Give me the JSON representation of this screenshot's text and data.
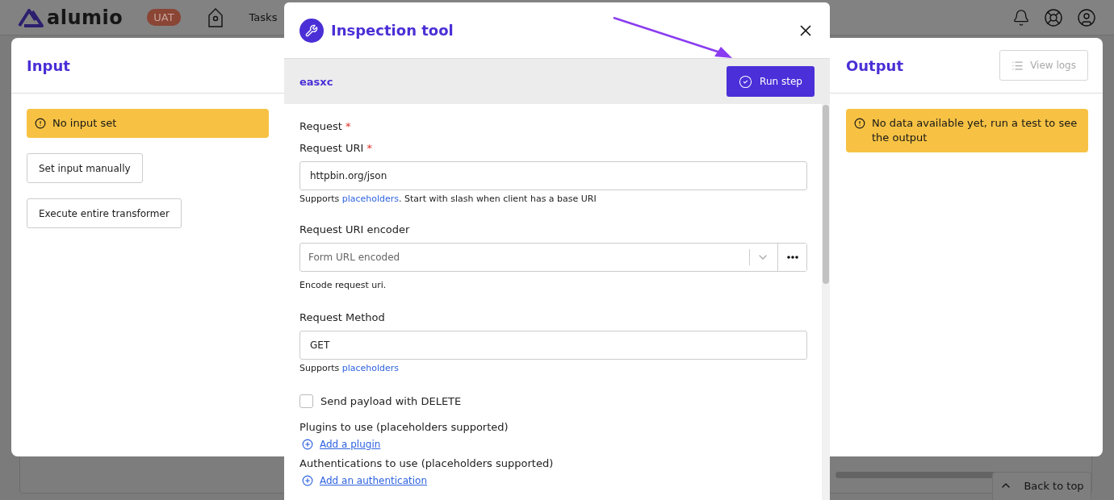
{
  "app_header": {
    "logo": "alumio",
    "env_badge": "UAT",
    "nav_items": [
      "Tasks"
    ]
  },
  "background": {
    "back_to_top": "Back to top"
  },
  "input_panel": {
    "title": "Input",
    "alert": "No input set",
    "buttons": [
      "Set input manually",
      "Execute entire transformer"
    ]
  },
  "output_panel": {
    "title": "Output",
    "view_logs": {
      "label": "View logs",
      "disabled": true
    },
    "alert": "No data available yet, run a test to see the output"
  },
  "inspection_tool": {
    "title": "Inspection tool",
    "step_name": "easxc",
    "run_button": "Run step",
    "form": [
      {
        "kind": "heading",
        "label": "Request",
        "required_mark": "*"
      },
      {
        "kind": "text",
        "label": "Request URI",
        "required_mark": "*",
        "value": "httpbin.org/json",
        "help_before": "Supports ",
        "help_link": "placeholders",
        "help_after": ". Start with slash when client has a base URI"
      },
      {
        "kind": "select",
        "label": "Request URI encoder",
        "value": "Form URL encoded",
        "help_before": "Encode request uri."
      },
      {
        "kind": "text",
        "label": "Request Method",
        "value": "GET",
        "help_before": "Supports ",
        "help_link": "placeholders"
      },
      {
        "kind": "checkbox",
        "label": "Send payload with DELETE",
        "checked": false
      },
      {
        "kind": "adder",
        "label": "Plugins to use (placeholders supported)",
        "action": "Add a plugin"
      },
      {
        "kind": "adder",
        "label": "Authentications to use (placeholders supported)",
        "action": "Add an authentication"
      }
    ]
  }
}
